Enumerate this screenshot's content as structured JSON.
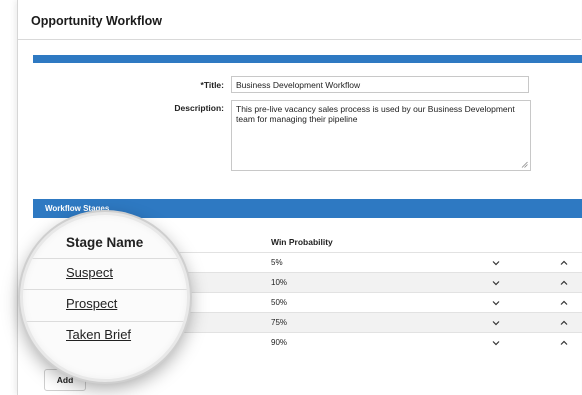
{
  "header": {
    "title": "Opportunity Workflow"
  },
  "form": {
    "title_label": "*Title:",
    "title_value": "Business Development Workflow",
    "description_label": "Description:",
    "description_value": "This pre-live vacancy  sales process is used by our Business Development team for managing their pipeline"
  },
  "stages": {
    "section_title": "Workflow Stages",
    "col_stage_name": "Stage Name",
    "col_win_probability": "Win Probability",
    "rows": [
      {
        "name": "Suspect",
        "probability": "5%"
      },
      {
        "name": "Prospect",
        "probability": "10%"
      },
      {
        "name": "",
        "probability": "50%"
      },
      {
        "name": "Taken Brief",
        "probability": "75%"
      },
      {
        "name": "",
        "probability": "90%"
      }
    ],
    "add_label": "Add"
  },
  "colors": {
    "accent": "#2e79c2",
    "row_alt": "#f2f2f2"
  },
  "icons": {
    "move_down": "chevron-down-icon",
    "move_up": "chevron-up-icon"
  }
}
